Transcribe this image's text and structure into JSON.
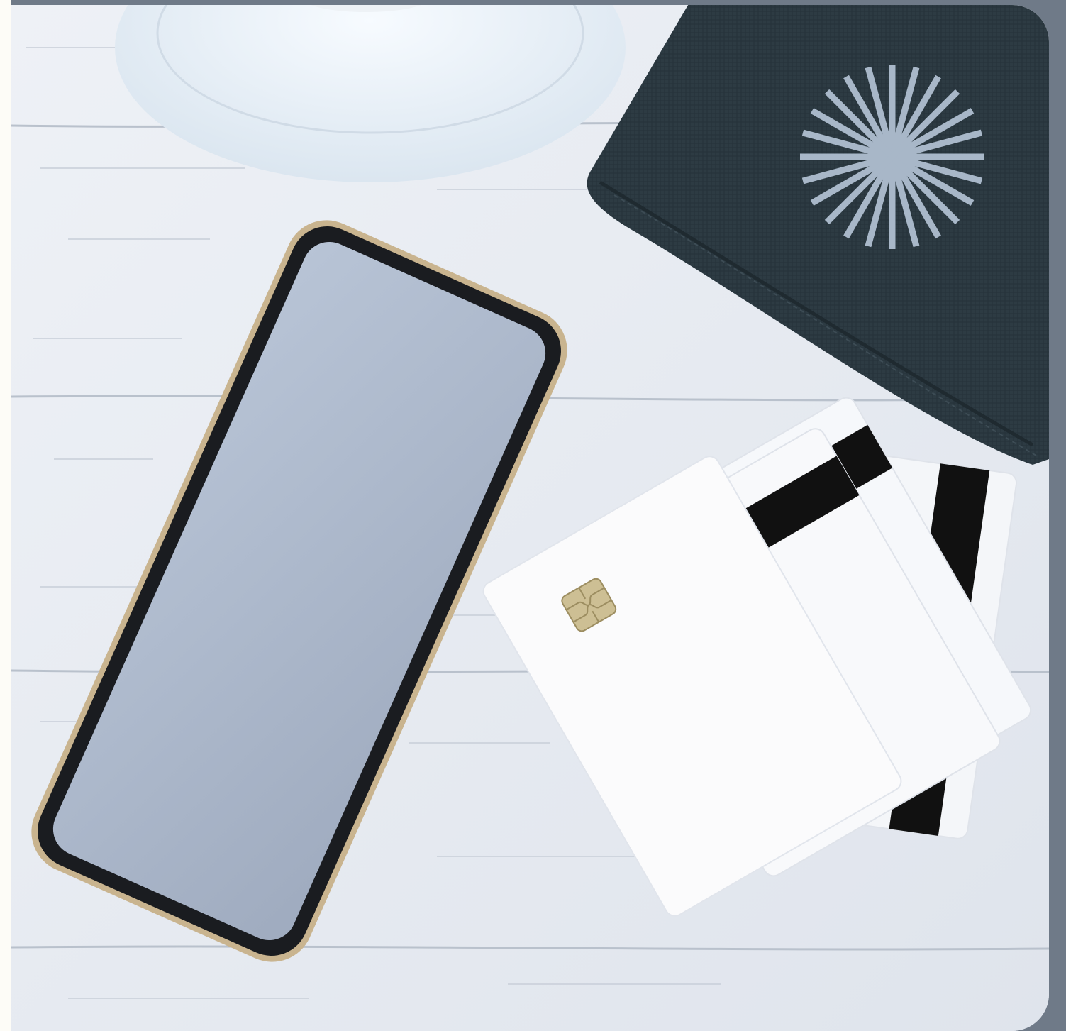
{
  "scene": {
    "subject": "photo",
    "colors": {
      "border": "#6f7a88",
      "wood": "#e8ecf2",
      "wallet": "#2c3a42",
      "screen": "#a9b6c9",
      "starburst": "#a8b7c8"
    },
    "icons": [
      "starburst-icon",
      "sim-chip-icon"
    ]
  }
}
